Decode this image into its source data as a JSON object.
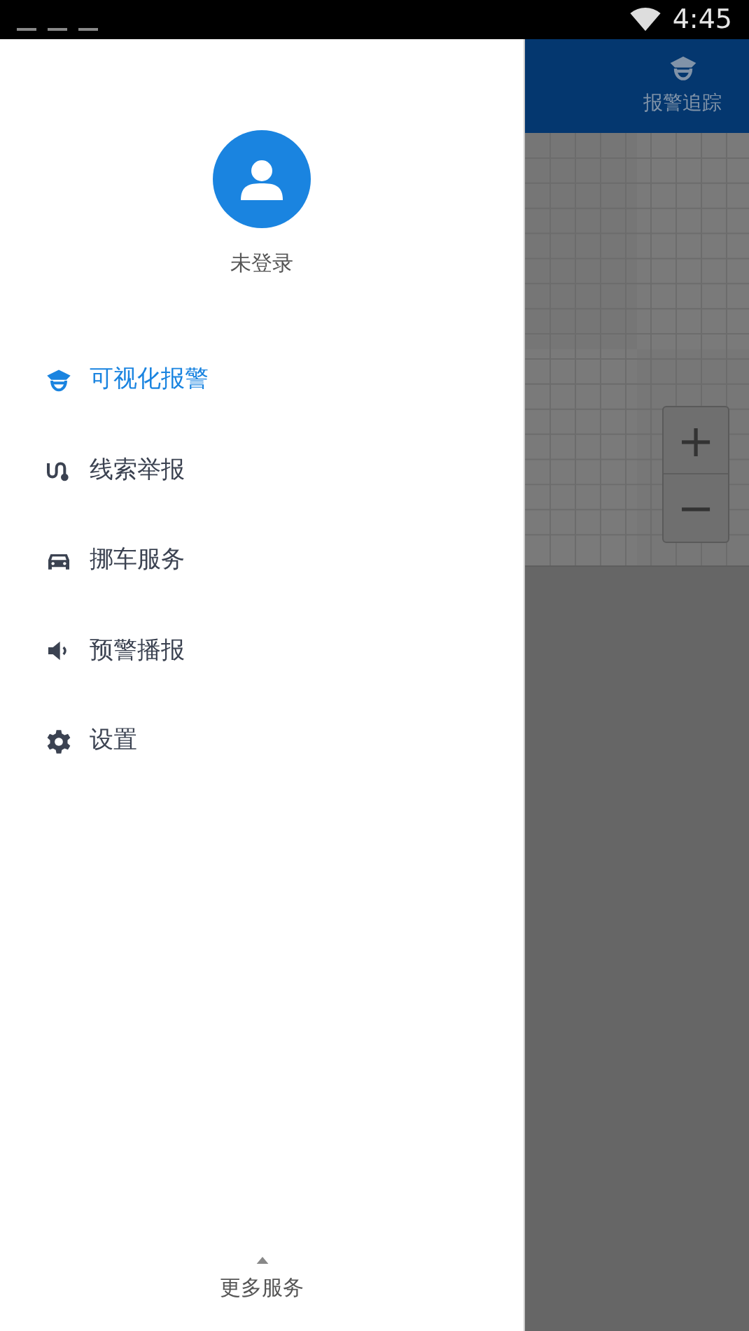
{
  "status_bar": {
    "time": "4:45"
  },
  "drawer": {
    "user": {
      "name": "未登录"
    },
    "menu": [
      {
        "label": "可视化报警",
        "selected": true
      },
      {
        "label": "线索举报",
        "selected": false
      },
      {
        "label": "挪车服务",
        "selected": false
      },
      {
        "label": "预警播报",
        "selected": false
      },
      {
        "label": "设置",
        "selected": false
      }
    ],
    "more": {
      "label": "更多服务"
    }
  },
  "background": {
    "tab": {
      "label": "报警追踪"
    },
    "zoom": {
      "in": "+",
      "out": "−"
    }
  }
}
